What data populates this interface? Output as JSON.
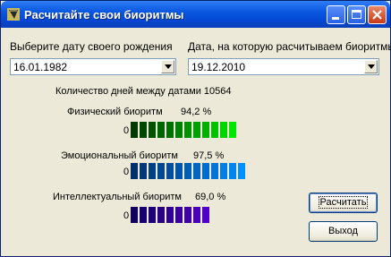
{
  "window": {
    "title": "Расчитайте свои биоритмы"
  },
  "birth": {
    "label": "Выберите дату своего рождения",
    "value": "16.01.1982"
  },
  "target": {
    "label": "Дата, на которую расчитываем биоритмы",
    "value": "19.12.2010"
  },
  "days": {
    "text": "Количество дней между датами 10564"
  },
  "biorhythms": {
    "physical": {
      "label": "Физический биоритм",
      "percent": "94,2 %",
      "zero": "0",
      "level": 0.942,
      "colors": [
        "#003c00",
        "#004800",
        "#005400",
        "#006400",
        "#007000",
        "#008000",
        "#009000",
        "#00a000",
        "#00b000",
        "#00c000",
        "#00d400",
        "#00e800",
        "#00ff00"
      ]
    },
    "emotional": {
      "label": "Эмоциональный биоритм",
      "percent": "97,5 %",
      "zero": "0",
      "level": 0.975,
      "colors": [
        "#00306c",
        "#003878",
        "#003f84",
        "#004690",
        "#004e9c",
        "#0055a8",
        "#005db3",
        "#0065bf",
        "#006dcb",
        "#0075d6",
        "#007de2",
        "#0085ee",
        "#0090ff"
      ]
    },
    "intellectual": {
      "label": "Интеллектуальный биоритм",
      "percent": "69,0 %",
      "zero": "0",
      "level": 0.69,
      "colors": [
        "#100060",
        "#18006c",
        "#200078",
        "#280084",
        "#300090",
        "#38009c",
        "#4000a8",
        "#4800b8",
        "#5000c8",
        "#5a00d8",
        "#6400e8",
        "#6e00f8",
        "#7800ff"
      ]
    }
  },
  "buttons": {
    "calc": "Расчитать",
    "exit": "Выход"
  },
  "icons": {
    "app": "app-icon",
    "minimize": "minimize-icon",
    "maximize": "maximize-icon",
    "close": "close-icon"
  }
}
